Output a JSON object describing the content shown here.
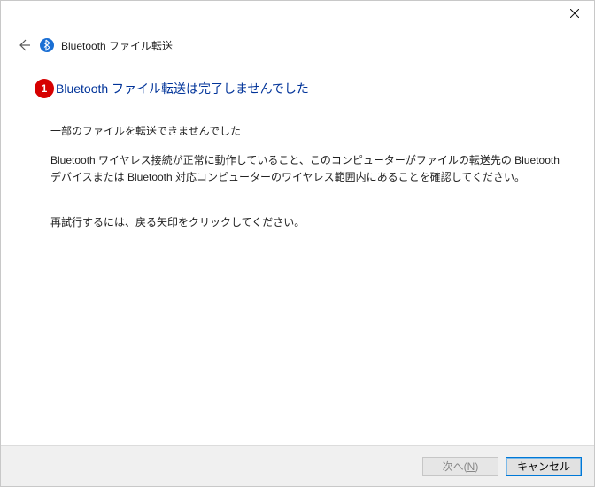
{
  "titlebar": {
    "close_label": "Close"
  },
  "header": {
    "back_label": "Back",
    "app_title": "Bluetooth ファイル転送"
  },
  "annotation": {
    "number": "1"
  },
  "main": {
    "title": "Bluetooth ファイル転送は完了しませんでした",
    "subheading": "一部のファイルを転送できませんでした",
    "paragraph": "Bluetooth ワイヤレス接続が正常に動作していること、このコンピューターがファイルの転送先の Bluetooth デバイスまたは Bluetooth 対応コンピューターのワイヤレス範囲内にあることを確認してください。",
    "retry": "再試行するには、戻る矢印をクリックしてください。"
  },
  "footer": {
    "next_label_prefix": "次へ(",
    "next_key": "N",
    "next_label_suffix": ")",
    "cancel_label": "キャンセル"
  }
}
